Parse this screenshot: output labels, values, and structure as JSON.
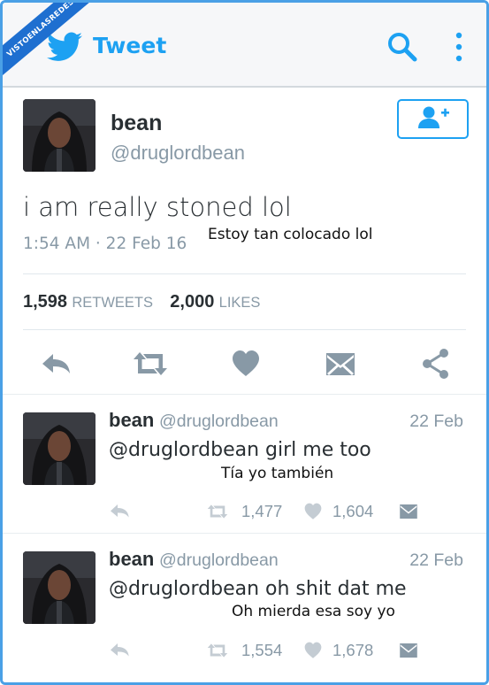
{
  "watermark": "VISTOENLASREDES",
  "header": {
    "title": "Tweet",
    "icons": [
      "twitter-bird-icon",
      "search-icon",
      "more-vert-icon"
    ],
    "accent": "#1da1f2"
  },
  "tweet": {
    "author": {
      "name": "bean",
      "handle": "@druglordbean"
    },
    "follow_icon": "add-user-icon",
    "text": "i am really stoned lol",
    "time": "1:54 AM · 22 Feb 16",
    "translation": "Estoy tan colocado lol",
    "retweets": {
      "count": "1,598",
      "label": "RETWEETS"
    },
    "likes": {
      "count": "2,000",
      "label": "LIKES"
    },
    "actions": [
      "reply-icon",
      "retweet-icon",
      "like-icon",
      "message-icon",
      "share-icon"
    ]
  },
  "replies": [
    {
      "name": "bean",
      "handle": "@druglordbean",
      "date": "22 Feb",
      "text": "@druglordbean girl me too",
      "translation": "Tía yo también",
      "retweets": "1,477",
      "likes": "1,604"
    },
    {
      "name": "bean",
      "handle": "@druglordbean",
      "date": "22 Feb",
      "text": "@druglordbean oh shit dat me",
      "translation": "Oh mierda esa soy yo",
      "retweets": "1,554",
      "likes": "1,678"
    }
  ],
  "colors": {
    "border": "#4aa0e6",
    "icon_gray": "#8899a6",
    "action_gray": "#c4ccd3",
    "text": "#292f33"
  }
}
